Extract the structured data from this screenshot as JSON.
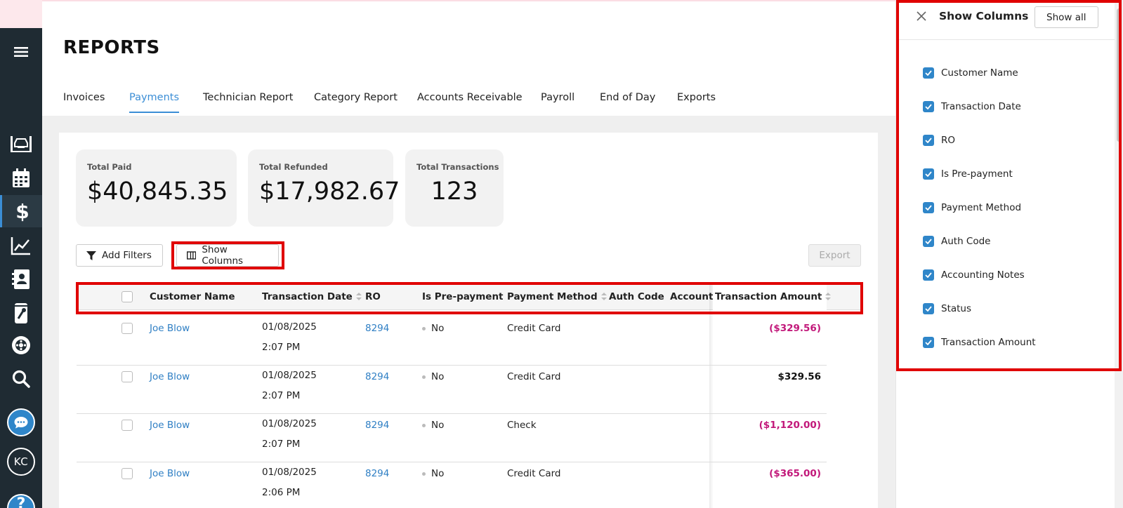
{
  "sidebar": {
    "items": [
      {
        "icon": "car-lift-icon"
      },
      {
        "icon": "calendar-icon"
      },
      {
        "icon": "dollar-icon",
        "active": true
      },
      {
        "icon": "chart-line-icon"
      },
      {
        "icon": "contacts-icon"
      },
      {
        "icon": "oil-can-icon"
      },
      {
        "icon": "tire-icon"
      },
      {
        "icon": "search-icon"
      }
    ],
    "avatar_initials": "KC",
    "help_label": "?"
  },
  "page": {
    "title": "REPORTS"
  },
  "tabs": [
    "Invoices",
    "Payments",
    "Technician Report",
    "Category Report",
    "Accounts Receivable",
    "Payroll",
    "End of Day",
    "Exports"
  ],
  "active_tab": "Payments",
  "stats": [
    {
      "label": "Total Paid",
      "value": "$40,845.35"
    },
    {
      "label": "Total Refunded",
      "value": "$17,982.67"
    },
    {
      "label": "Total Transactions",
      "value": "123"
    }
  ],
  "toolbar": {
    "add_filters": "Add Filters",
    "show_columns": "Show Columns",
    "export": "Export"
  },
  "table": {
    "columns": [
      "Customer Name",
      "Transaction Date",
      "RO",
      "Is Pre-payment",
      "Payment Method",
      "Auth Code",
      "Account",
      "Transaction Amount"
    ],
    "rows": [
      {
        "customer": "Joe Blow",
        "date": "01/08/2025",
        "time": "2:07 PM",
        "ro": "8294",
        "prepayment": "No",
        "method": "Credit Card",
        "amount": "($329.56)",
        "negative": true
      },
      {
        "customer": "Joe Blow",
        "date": "01/08/2025",
        "time": "2:07 PM",
        "ro": "8294",
        "prepayment": "No",
        "method": "Credit Card",
        "amount": "$329.56",
        "negative": false
      },
      {
        "customer": "Joe Blow",
        "date": "01/08/2025",
        "time": "2:07 PM",
        "ro": "8294",
        "prepayment": "No",
        "method": "Check",
        "amount": "($1,120.00)",
        "negative": true
      },
      {
        "customer": "Joe Blow",
        "date": "01/08/2025",
        "time": "2:06 PM",
        "ro": "8294",
        "prepayment": "No",
        "method": "Credit Card",
        "amount": "($365.00)",
        "negative": true
      }
    ]
  },
  "drawer": {
    "title": "Show Columns",
    "show_all": "Show all",
    "columns": [
      "Customer Name",
      "Transaction Date",
      "RO",
      "Is Pre-payment",
      "Payment Method",
      "Auth Code",
      "Accounting Notes",
      "Status",
      "Transaction Amount"
    ]
  },
  "colors": {
    "accent": "#2f86c9",
    "negative": "#c2187a",
    "highlight": "#e00000",
    "sidebar": "#1f2b33"
  }
}
